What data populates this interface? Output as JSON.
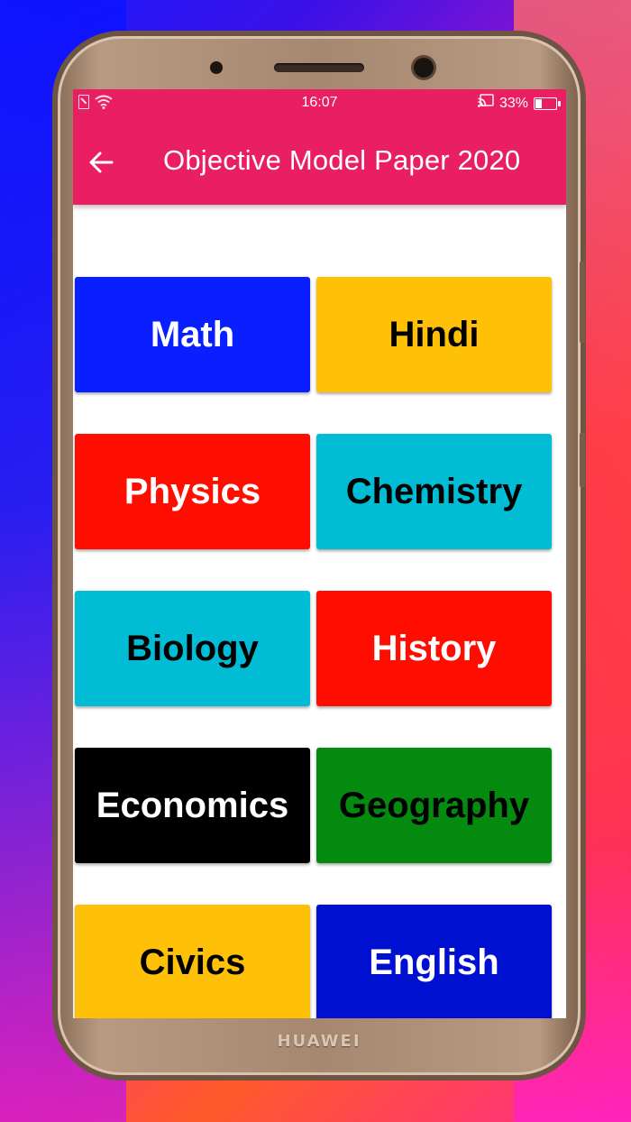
{
  "device": {
    "brand": "HUAWEI"
  },
  "status_bar": {
    "time": "16:07",
    "battery_percent": "33%",
    "battery_level": 0.33,
    "icons_left": [
      "sim-off-icon",
      "wifi-icon"
    ],
    "icons_right": [
      "cast-icon",
      "battery-icon"
    ]
  },
  "app_bar": {
    "title": "Objective Model Paper 2020",
    "back_icon": "arrow-left-icon",
    "color": "#e91e63"
  },
  "subjects": [
    {
      "label": "Math",
      "bg": "#0a1fff",
      "fg": "#ffffff"
    },
    {
      "label": "Hindi",
      "bg": "#ffc107",
      "fg": "#000000"
    },
    {
      "label": "Physics",
      "bg": "#ff0d00",
      "fg": "#ffffff"
    },
    {
      "label": "Chemistry",
      "bg": "#00bcd4",
      "fg": "#000000"
    },
    {
      "label": "Biology",
      "bg": "#00bcd4",
      "fg": "#000000"
    },
    {
      "label": "History",
      "bg": "#ff0d00",
      "fg": "#ffffff"
    },
    {
      "label": "Economics",
      "bg": "#000000",
      "fg": "#ffffff"
    },
    {
      "label": "Geography",
      "bg": "#038a0f",
      "fg": "#000000"
    },
    {
      "label": "Civics",
      "bg": "#ffc107",
      "fg": "#000000"
    },
    {
      "label": "English",
      "bg": "#0010d0",
      "fg": "#ffffff"
    }
  ]
}
